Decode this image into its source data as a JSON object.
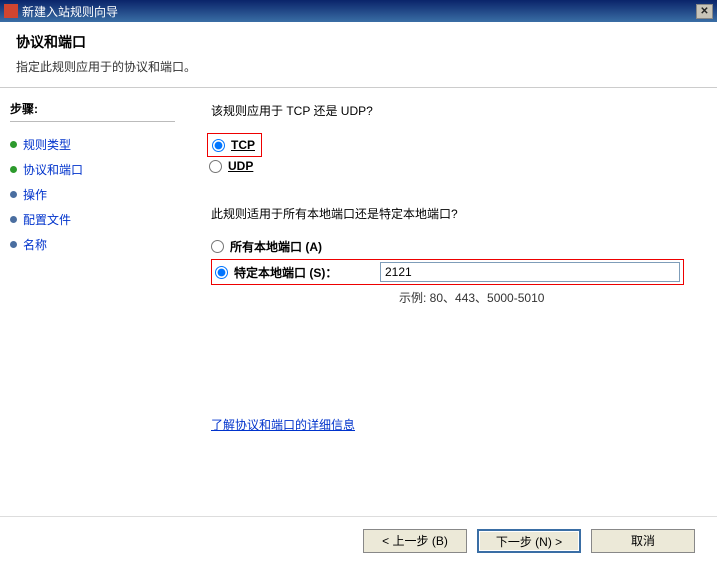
{
  "window": {
    "title": "新建入站规则向导"
  },
  "header": {
    "title": "协议和端口",
    "subtitle": "指定此规则应用于的协议和端口。"
  },
  "sidebar": {
    "heading": "步骤:",
    "steps": [
      {
        "label": "规则类型",
        "state": "done"
      },
      {
        "label": "协议和端口",
        "state": "current"
      },
      {
        "label": "操作",
        "state": "pending"
      },
      {
        "label": "配置文件",
        "state": "pending"
      },
      {
        "label": "名称",
        "state": "pending"
      }
    ]
  },
  "content": {
    "protocol_question": "该规则应用于 TCP 还是 UDP?",
    "protocol_options": {
      "tcp": "TCP",
      "udp": "UDP"
    },
    "protocol_selected": "tcp",
    "port_question": "此规则适用于所有本地端口还是特定本地端口?",
    "port_options": {
      "all": "所有本地端口 (A)",
      "specific": "特定本地端口 (S)："
    },
    "port_selected": "specific",
    "port_value": "2121",
    "port_example": "示例: 80、443、5000-5010",
    "info_link": "了解协议和端口的详细信息"
  },
  "footer": {
    "back": "< 上一步 (B)",
    "next": "下一步 (N) >",
    "cancel": "取消"
  }
}
